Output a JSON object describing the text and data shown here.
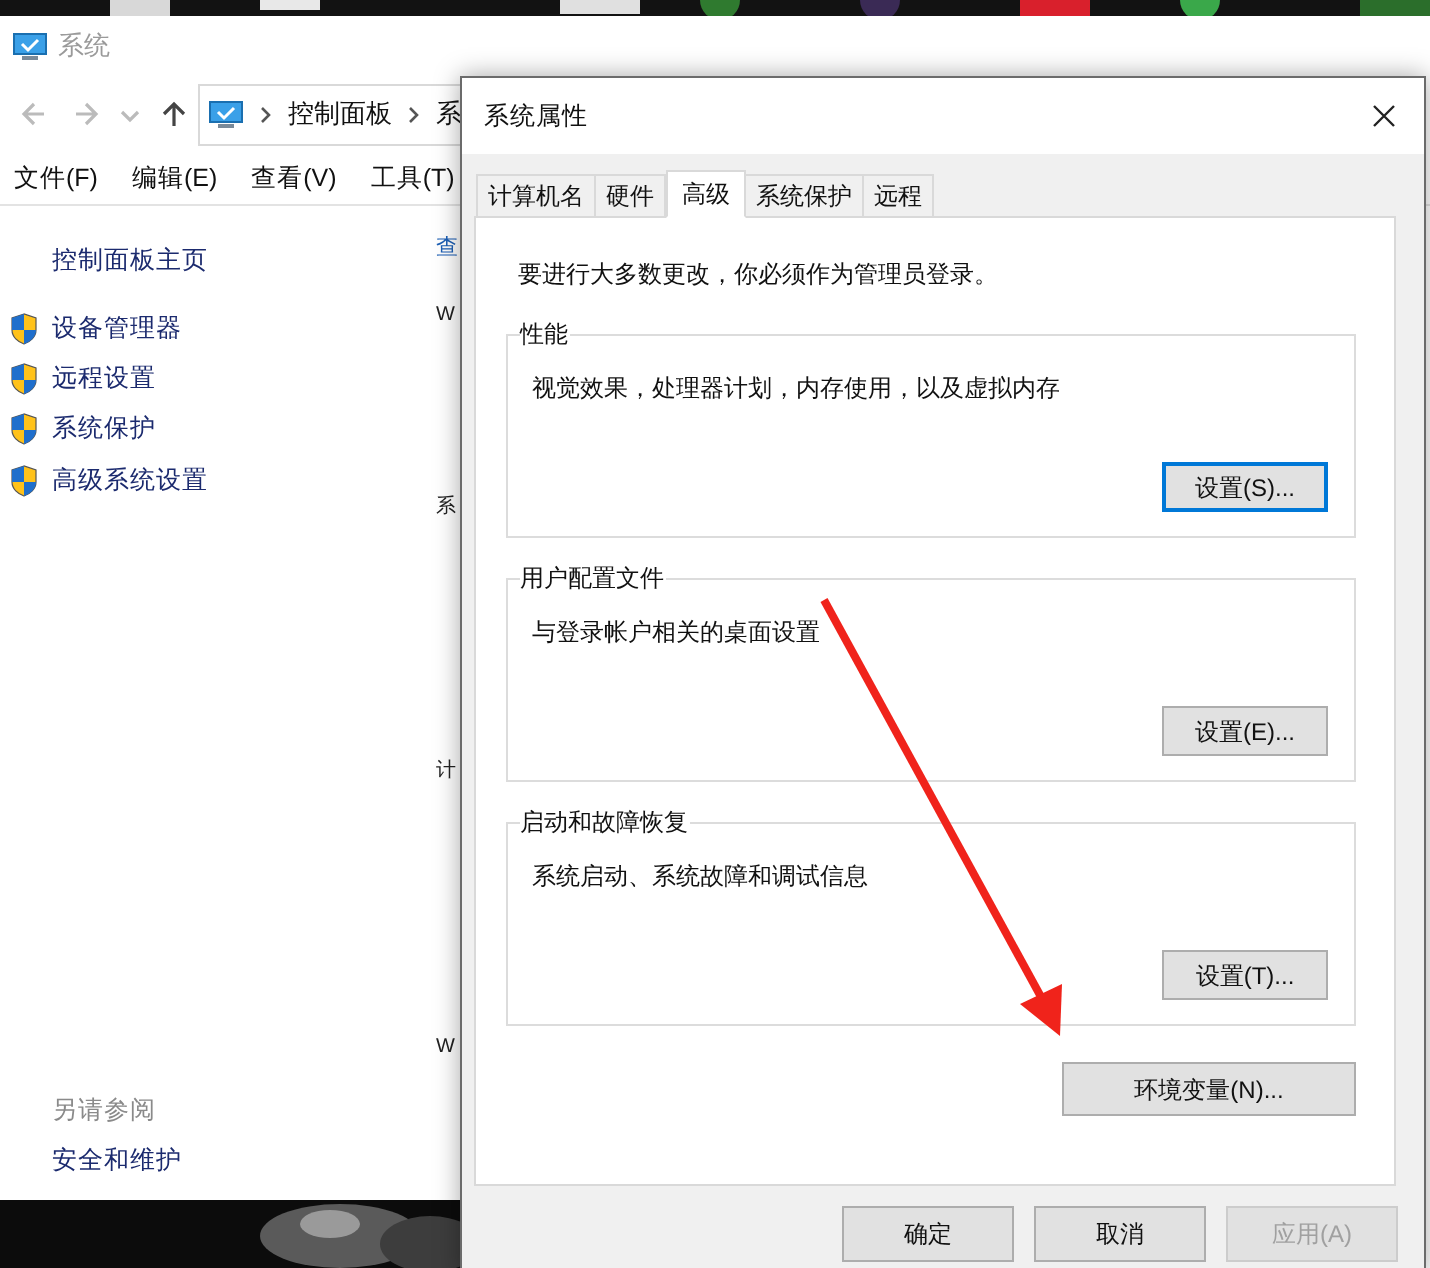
{
  "explorer": {
    "title": "系统",
    "address": [
      "控制面板",
      "系"
    ],
    "menu": [
      "文件(F)",
      "编辑(E)",
      "查看(V)",
      "工具(T)"
    ],
    "sidebar": {
      "home": "控制面板主页",
      "items": [
        "设备管理器",
        "远程设置",
        "系统保护",
        "高级系统设置"
      ],
      "see_also_heading": "另请参阅",
      "see_also": [
        "安全和维护"
      ]
    },
    "main_fragments": [
      {
        "text": "查",
        "kind": "link"
      },
      {
        "text": "W",
        "kind": "text"
      },
      {
        "text": "系",
        "kind": "text"
      },
      {
        "text": "计",
        "kind": "text"
      },
      {
        "text": "W",
        "kind": "text"
      }
    ]
  },
  "dialog": {
    "title": "系统属性",
    "tabs": [
      {
        "label": "计算机名",
        "selected": false
      },
      {
        "label": "硬件",
        "selected": false
      },
      {
        "label": "高级",
        "selected": true
      },
      {
        "label": "系统保护",
        "selected": false
      },
      {
        "label": "远程",
        "selected": false
      }
    ],
    "notice": "要进行大多数更改，你必须作为管理员登录。",
    "groups": [
      {
        "title": "性能",
        "description": "视觉效果，处理器计划，内存使用，以及虚拟内存",
        "button": {
          "label": "设置(S)...",
          "focused": true
        }
      },
      {
        "title": "用户配置文件",
        "description": "与登录帐户相关的桌面设置",
        "button": {
          "label": "设置(E)...",
          "focused": false
        }
      },
      {
        "title": "启动和故障恢复",
        "description": "系统启动、系统故障和调试信息",
        "button": {
          "label": "设置(T)...",
          "focused": false
        }
      }
    ],
    "env_button": "环境变量(N)...",
    "buttons": [
      {
        "label": "确定",
        "disabled": false
      },
      {
        "label": "取消",
        "disabled": false
      },
      {
        "label": "应用(A)",
        "disabled": true
      }
    ]
  }
}
